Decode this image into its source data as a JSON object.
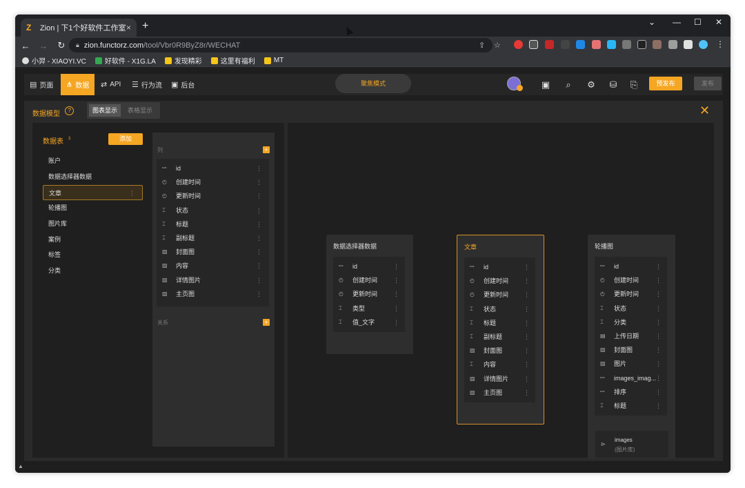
{
  "browser": {
    "tab_title": "Zion | 下1个好软件工作室",
    "tab_favicon": "Z",
    "tab_close": "×",
    "new_tab": "+",
    "url_host": "zion.functorz.com",
    "url_path": "/tool/Vbr0R9ByZ8r/WECHAT",
    "win_controls": [
      "⌄",
      "—",
      "☐",
      "✕"
    ]
  },
  "bookmarks": [
    {
      "label": "小羿 - XIAOYI.VC",
      "color": "#dddddd"
    },
    {
      "label": "好软件 - X1G.LA",
      "color": "#34a853"
    },
    {
      "label": "发现精彩",
      "color": "#f5c518"
    },
    {
      "label": "这里有福利",
      "color": "#f5c518"
    },
    {
      "label": "MT",
      "color": "#f5c518"
    }
  ],
  "app_nav": [
    {
      "label": "页面",
      "icon": "page-icon",
      "glyph": "▤",
      "active": false
    },
    {
      "label": "数据",
      "icon": "data-icon",
      "glyph": "⋔",
      "active": true
    },
    {
      "label": "API",
      "icon": "api-icon",
      "glyph": "⇄",
      "active": false
    },
    {
      "label": "行为流",
      "icon": "flow-icon",
      "glyph": "☰",
      "active": false
    },
    {
      "label": "后台",
      "icon": "admin-icon",
      "glyph": "▣",
      "active": false
    }
  ],
  "mode_label": "聚焦模式",
  "tools": {
    "prepublish_label": "预发布",
    "publish_label": "发布"
  },
  "panel": {
    "title": "数据模型",
    "view_chart": "图表显示",
    "view_table": "表格显示"
  },
  "tables": {
    "title": "数据表",
    "add_label": "添加",
    "items": [
      "账户",
      "数据选择器数据",
      "文章",
      "轮播图",
      "图片库",
      "案例",
      "标签",
      "分类"
    ],
    "selected_index": 2
  },
  "columns": {
    "section_label": "列",
    "relations_label": "关系",
    "rows": [
      {
        "icon": "ꟷ",
        "name": "id"
      },
      {
        "icon": "◴",
        "name": "创建时间"
      },
      {
        "icon": "◴",
        "name": "更新时间"
      },
      {
        "icon": "⌶",
        "name": "状态"
      },
      {
        "icon": "⌶",
        "name": "标题"
      },
      {
        "icon": "⌶",
        "name": "副标题"
      },
      {
        "icon": "▨",
        "name": "封面图"
      },
      {
        "icon": "▨",
        "name": "内容"
      },
      {
        "icon": "▨",
        "name": "详情图片"
      },
      {
        "icon": "▨",
        "name": "主页图"
      }
    ]
  },
  "entities": [
    {
      "title": "数据选择器数据",
      "active": false,
      "rows": [
        {
          "icon": "ꟷ",
          "name": "id"
        },
        {
          "icon": "◴",
          "name": "创建时间"
        },
        {
          "icon": "◴",
          "name": "更新时间"
        },
        {
          "icon": "⌶",
          "name": "类型"
        },
        {
          "icon": "⌶",
          "name": "值_文字"
        }
      ]
    },
    {
      "title": "文章",
      "active": true,
      "rows": [
        {
          "icon": "ꟷ",
          "name": "id"
        },
        {
          "icon": "◴",
          "name": "创建时间"
        },
        {
          "icon": "◴",
          "name": "更新时间"
        },
        {
          "icon": "⌶",
          "name": "状态"
        },
        {
          "icon": "⌶",
          "name": "标题"
        },
        {
          "icon": "⌶",
          "name": "副标题"
        },
        {
          "icon": "▨",
          "name": "封面图"
        },
        {
          "icon": "⌶",
          "name": "内容"
        },
        {
          "icon": "▨",
          "name": "详情图片"
        },
        {
          "icon": "▨",
          "name": "主页图"
        }
      ]
    },
    {
      "title": "轮播图",
      "active": false,
      "rows": [
        {
          "icon": "ꟷ",
          "name": "id"
        },
        {
          "icon": "◴",
          "name": "创建时间"
        },
        {
          "icon": "◴",
          "name": "更新时间"
        },
        {
          "icon": "⌶",
          "name": "状态"
        },
        {
          "icon": "⌶",
          "name": "分类"
        },
        {
          "icon": "▤",
          "name": "上传日期"
        },
        {
          "icon": "▨",
          "name": "封面图"
        },
        {
          "icon": "▨",
          "name": "图片"
        },
        {
          "icon": "ꟷ",
          "name": "images_imag..."
        },
        {
          "icon": "ꟷ",
          "name": "排序"
        },
        {
          "icon": "⌶",
          "name": "标题"
        }
      ],
      "relation": {
        "name": "images",
        "sub": "(图片库)"
      }
    }
  ],
  "colors": {
    "accent": "#f5a623",
    "background": "#1e1e1e"
  }
}
